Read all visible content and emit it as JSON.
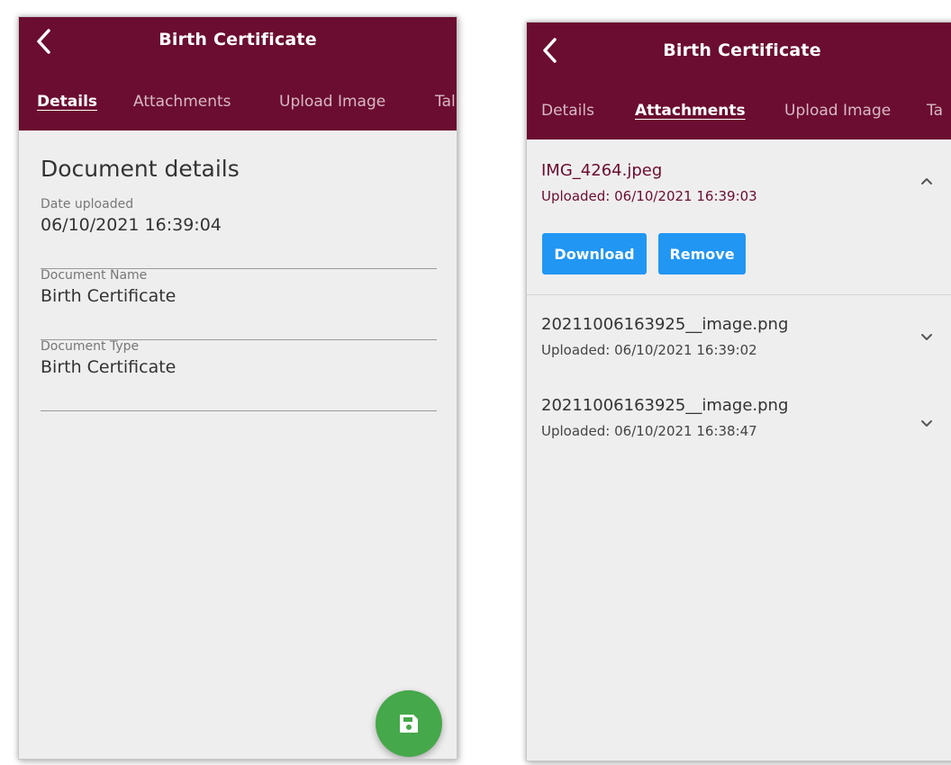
{
  "left_screen": {
    "title": "Birth Certificate",
    "tabs": [
      {
        "label": "Details",
        "active": true
      },
      {
        "label": "Attachments",
        "active": false
      },
      {
        "label": "Upload Image",
        "active": false
      },
      {
        "label": "Tal",
        "active": false
      }
    ],
    "section_title": "Document details",
    "fields": [
      {
        "label": "Date uploaded",
        "value": "06/10/2021 16:39:04"
      },
      {
        "label": "Document Name",
        "value": "Birth Certificate"
      },
      {
        "label": "Document Type",
        "value": "Birth Certificate"
      }
    ],
    "fab_icon": "save-icon"
  },
  "right_screen": {
    "title": "Birth Certificate",
    "tabs": [
      {
        "label": "Details",
        "active": false
      },
      {
        "label": "Attachments",
        "active": true
      },
      {
        "label": "Upload Image",
        "active": false
      },
      {
        "label": "Ta",
        "active": false
      }
    ],
    "attachments": [
      {
        "name": "IMG_4264.jpeg",
        "uploaded": "Uploaded: 06/10/2021 16:39:03",
        "expanded": true,
        "icon": "chevron-up-icon"
      },
      {
        "name": "20211006163925__image.png",
        "uploaded": "Uploaded: 06/10/2021 16:39:02",
        "expanded": false,
        "icon": "chevron-down-icon"
      },
      {
        "name": "20211006163925__image.png",
        "uploaded": "Uploaded: 06/10/2021 16:38:47",
        "expanded": false,
        "icon": "chevron-down-icon"
      }
    ],
    "actions": {
      "download_label": "Download",
      "remove_label": "Remove"
    }
  },
  "colors": {
    "appbar": "#6b0d30",
    "button": "#2196f3",
    "fab": "#45a84a",
    "background": "#efeeef"
  }
}
